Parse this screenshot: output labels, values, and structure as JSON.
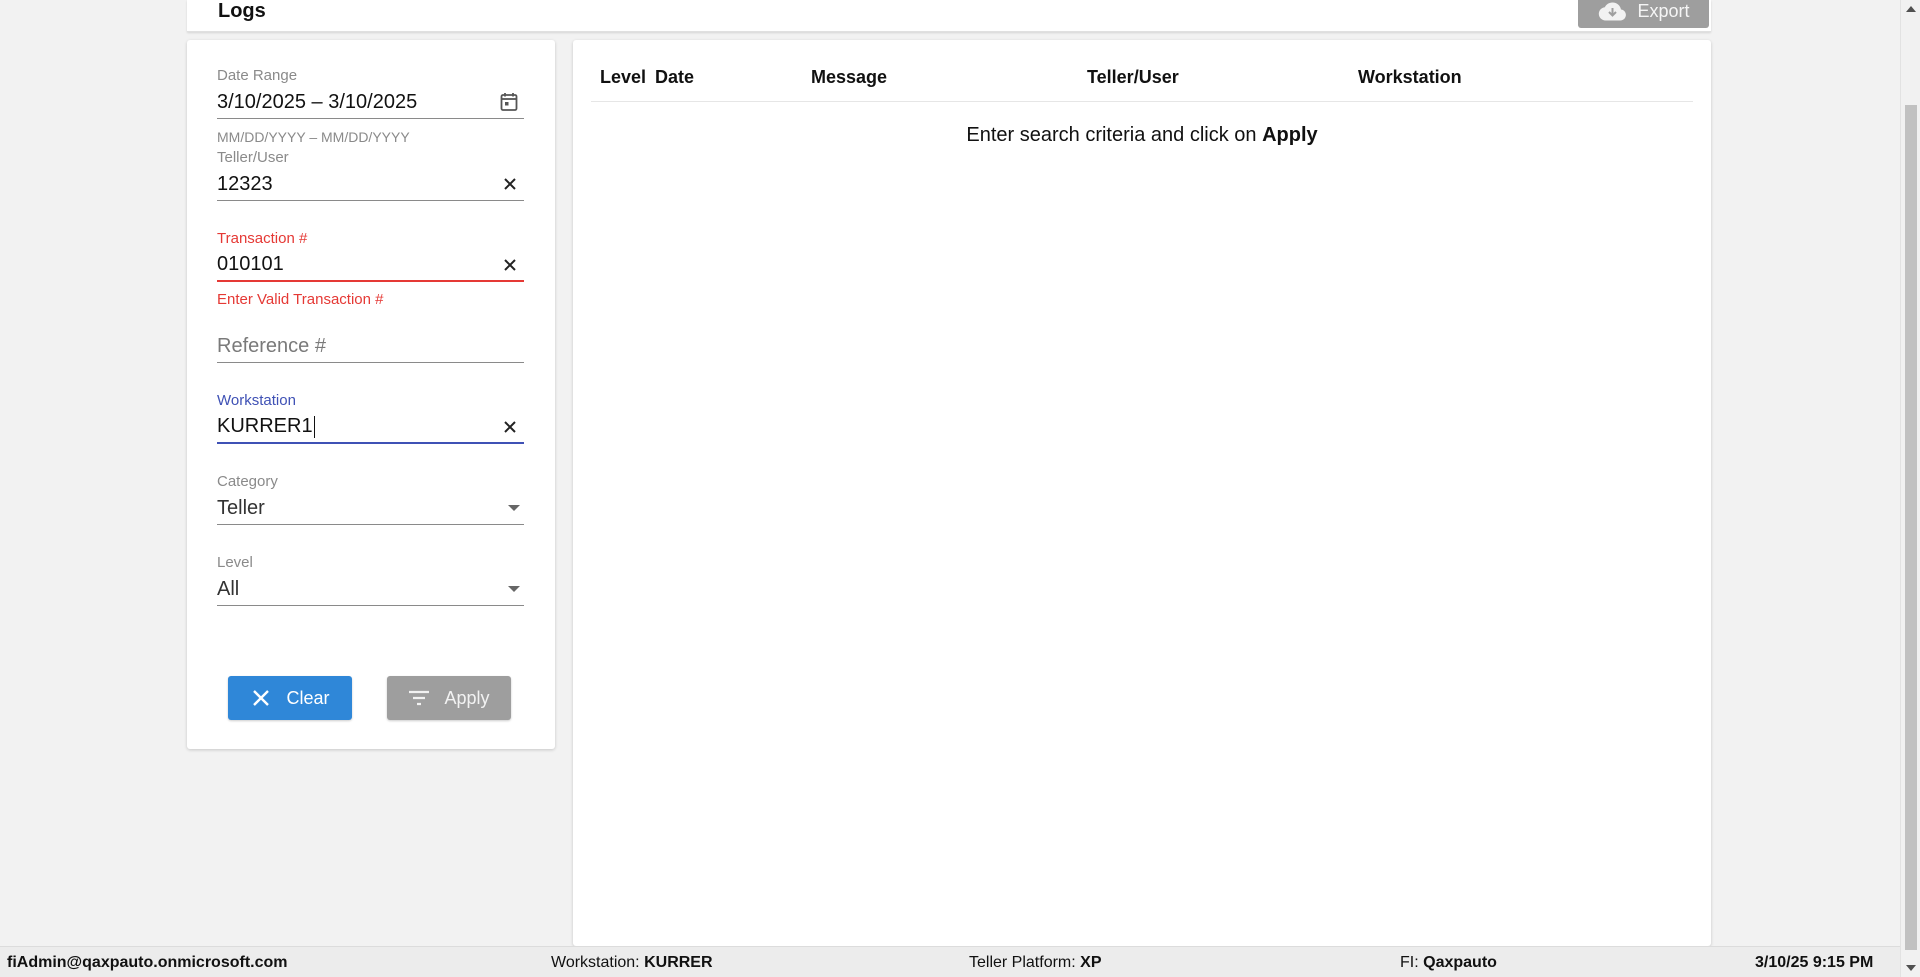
{
  "header": {
    "title": "Logs",
    "export_label": "Export"
  },
  "filters": {
    "date_range": {
      "label": "Date Range",
      "value": "3/10/2025 – 3/10/2025",
      "hint": "MM/DD/YYYY – MM/DD/YYYY"
    },
    "teller_user": {
      "label": "Teller/User",
      "value": "12323"
    },
    "transaction": {
      "label": "Transaction #",
      "value": "010101",
      "error": "Enter Valid Transaction #"
    },
    "reference": {
      "placeholder": "Reference #"
    },
    "workstation": {
      "label": "Workstation",
      "value": "KURRER1"
    },
    "category": {
      "label": "Category",
      "value": "Teller"
    },
    "level": {
      "label": "Level",
      "value": "All"
    },
    "clear_label": "Clear",
    "apply_label": "Apply"
  },
  "results": {
    "columns": [
      "Level",
      "Date",
      "Message",
      "Teller/User",
      "Workstation"
    ],
    "empty_prefix": "Enter search criteria and click on ",
    "empty_action": "Apply"
  },
  "footer": {
    "user": "fiAdmin@qaxpauto.onmicrosoft.com",
    "workstation_label": "Workstation:",
    "workstation_value": "KURRER",
    "platform_label": "Teller Platform:",
    "platform_value": "XP",
    "fi_label": "FI:",
    "fi_value": "Qaxpauto",
    "datetime": "3/10/25 9:15 PM"
  },
  "colors": {
    "primary": "#2f87d8",
    "error": "#e53935",
    "focus": "#3f51b5",
    "disabled": "#9e9e9e"
  }
}
